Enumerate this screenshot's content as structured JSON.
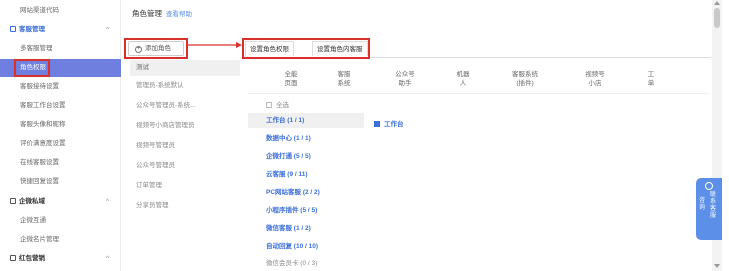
{
  "sidebar": {
    "top_item": "网站渠道代码",
    "groups": [
      {
        "label": "客服管理"
      },
      {
        "label": "企微私域"
      },
      {
        "label": "红包营销"
      }
    ],
    "items": [
      "多客服管理",
      "角色权限",
      "客服接待设置",
      "客服工作台设置",
      "客服头像和昵称",
      "评价满意度设置",
      "在线客服设置",
      "快捷回复设置",
      "企微互通",
      "企微名片管理"
    ],
    "chevron": "^"
  },
  "main": {
    "title": "角色管理",
    "help": "查看帮助",
    "add_button": "添加角色",
    "roles": [
      "测试",
      "管理员-系统默认",
      "公众号管理员-系统...",
      "视频号小商店管理员",
      "视频号管理员",
      "公众号管理员",
      "订单管理",
      "分享员管理"
    ],
    "tabs": [
      "设置角色权限",
      "设置角色内客服"
    ],
    "categories": [
      {
        "l1": "全能",
        "l2": "页面"
      },
      {
        "l1": "客服",
        "l2": "系统"
      },
      {
        "l1": "公众号",
        "l2": "助手"
      },
      {
        "l1": "机器",
        "l2": "人"
      },
      {
        "l1": "客服系统",
        "l2": "(插件)"
      },
      {
        "l1": "视频号",
        "l2": "小店"
      },
      {
        "l1": "工",
        "l2": "单"
      }
    ],
    "select_all": "全选",
    "subcategories": [
      "工作台 (1 / 1)",
      "数据中心 (1 / 1)",
      "企微打通 (5 / 5)",
      "云客服 (9 / 11)",
      "PC网站客服 (2 / 2)",
      "小程序插件 (5 / 5)",
      "微信客服 (1 / 2)",
      "自动回复 (10 / 10)",
      "微信会员卡 (0 / 3)"
    ],
    "perm_item": "工作台"
  },
  "float_widget": {
    "col1": "咨询",
    "col2": "联系客服",
    "icon": "headset-icon"
  },
  "colors": {
    "accent": "#3b6fd9",
    "active": "#6f7fe0",
    "highlight": "#d9302c"
  }
}
